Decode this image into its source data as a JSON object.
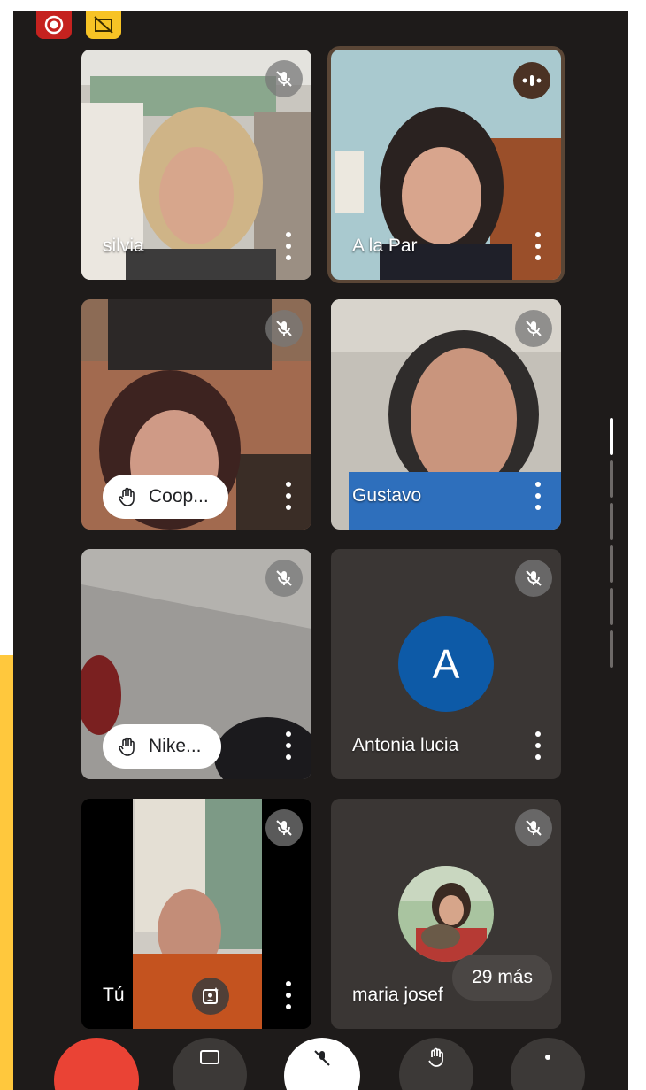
{
  "participants": [
    {
      "name": "silvia",
      "muted": true
    },
    {
      "name": "A la Par",
      "speaking": true
    },
    {
      "name": "Coop...",
      "hand_raised": true,
      "muted": true
    },
    {
      "name": "Gustavo",
      "muted": true
    },
    {
      "name": "Nike...",
      "hand_raised": true,
      "muted": true
    },
    {
      "name": "Antonia lucia",
      "avatar_letter": "A",
      "avatar_color": "#0d5aa7",
      "muted": true
    },
    {
      "name": "Tú",
      "muted": true,
      "self": true
    },
    {
      "name": "maria josef",
      "muted": true
    }
  ],
  "more_participants_label": "29 más",
  "colors": {
    "background": "#1e1b1a",
    "tile": "#3a3634",
    "record": "#d93025",
    "accent_yellow": "#ffc83d",
    "speaking_border": "#5a4636"
  },
  "icons": [
    "record-icon",
    "no-video-icon",
    "mic-off-icon",
    "speaking-indicator-icon",
    "raised-hand-icon",
    "more-vert-icon",
    "visual-effects-icon"
  ]
}
